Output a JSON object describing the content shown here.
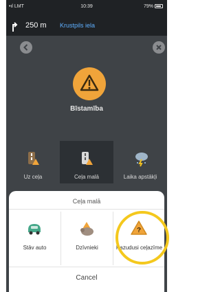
{
  "status_bar": {
    "carrier": "LMT",
    "time": "10:39",
    "battery": "79%"
  },
  "navigation": {
    "distance": "250 m",
    "street": "Krustpils iela"
  },
  "alert": {
    "title": "Bīstamība"
  },
  "categories": [
    {
      "label": "Uz ceļa",
      "icon": "road-hazard-icon"
    },
    {
      "label": "Ceļa malā",
      "icon": "roadside-hazard-icon",
      "selected": true
    },
    {
      "label": "Laika apstākļi",
      "icon": "weather-icon"
    }
  ],
  "sheet": {
    "title": "Ceļa malā",
    "options": [
      {
        "label": "Stāv auto",
        "icon": "stopped-car-icon"
      },
      {
        "label": "Dzīvnieki",
        "icon": "animal-icon"
      },
      {
        "label": "Pazudusi ceļazīme",
        "icon": "missing-sign-icon"
      }
    ],
    "cancel_label": "Cancel"
  },
  "colors": {
    "accent": "#f0a43a",
    "highlight": "#f4c81d",
    "link": "#5fb0ff"
  }
}
